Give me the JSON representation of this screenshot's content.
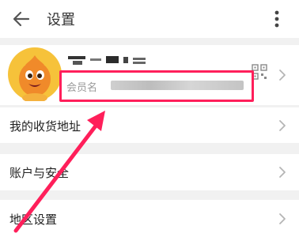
{
  "header": {
    "title": "设置"
  },
  "profile": {
    "member_label": "会员名"
  },
  "rows": [
    {
      "label": "我的收货地址"
    },
    {
      "label": "账户与安全"
    },
    {
      "label": "地区设置"
    }
  ],
  "colors": {
    "highlight": "#ff1f5a",
    "background": "#f1f1f1"
  }
}
